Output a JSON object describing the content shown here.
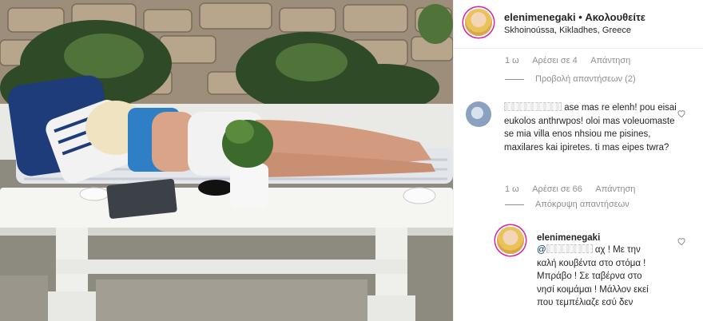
{
  "post": {
    "username": "elenimenegaki",
    "separator": "•",
    "follow_status": "Ακολουθείτε",
    "location": "Skhoinoússa, Kikladhes, Greece"
  },
  "first_meta": {
    "time": "1 ω",
    "likes": "Αρέσει σε 4",
    "reply": "Απάντηση"
  },
  "view_replies": "Προβολή απαντήσεων (2)",
  "comment": {
    "text_before": "",
    "text": "ase mas re elenh! pou eisai eukolos anthrwpos! oloi mas voleuomaste se mia villa enos nhsiou me pisines, maxilares kai ipiretes. ti mas eipes twra?",
    "time": "1 ω",
    "likes": "Αρέσει σε 66",
    "reply": "Απάντηση",
    "hide_replies": "Απόκρυψη απαντήσεων"
  },
  "reply": {
    "username": "elenimenegaki",
    "mention": "@",
    "text": "αχ ! Με την καλή κουβέντα στο στόμα ! Μπράβο ! Σε ταβέρνα στο νησί κοιμάμαι ! Μάλλον εκεί που τεμπέλιαζε εσύ δεν"
  },
  "icons": {
    "heart": "heart-outline-icon"
  },
  "colors": {
    "text": "#262626",
    "muted": "#8e8e8e",
    "divider": "#efefef",
    "story_ring": "#d6249f"
  }
}
